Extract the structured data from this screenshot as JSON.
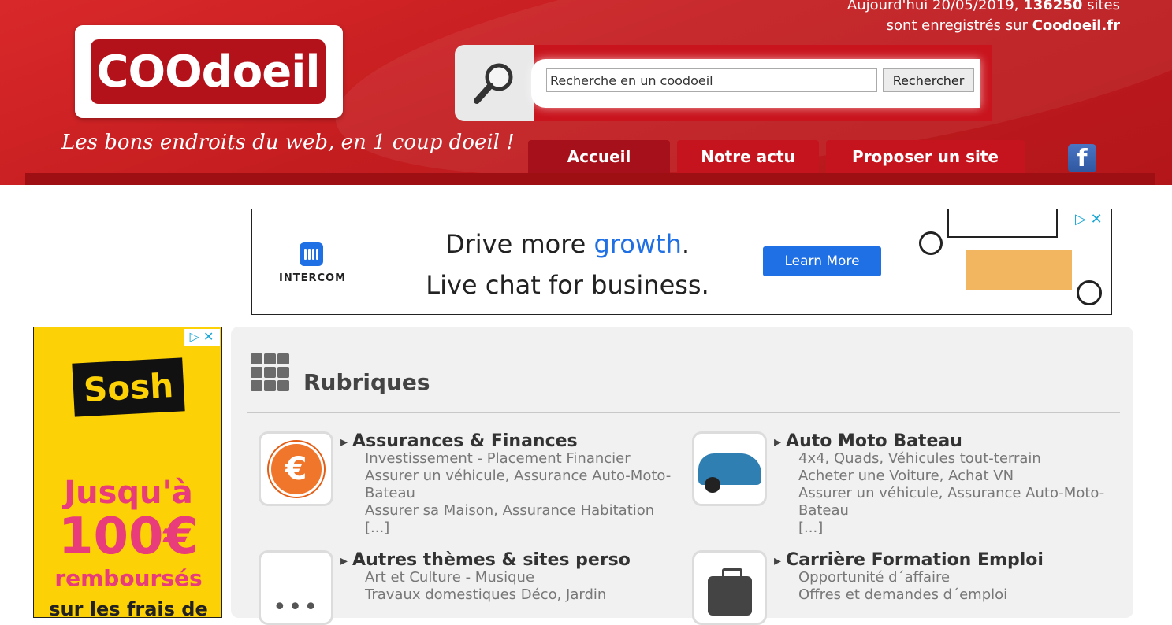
{
  "header": {
    "date_prefix": "Aujourd'hui 20/05/2019,",
    "site_count": "136250",
    "date_suffix": "sites",
    "registered_line": "sont enregistrés sur",
    "site_name": "Coodoeil.fr",
    "logo_text": "COOdoeil",
    "tagline": "Les bons endroits du web, en 1 coup doeil !"
  },
  "search": {
    "input_value": "Recherche en un coodoeil",
    "button_label": "Rechercher"
  },
  "nav": {
    "items": [
      {
        "label": "Accueil"
      },
      {
        "label": "Notre actu"
      },
      {
        "label": "Proposer un site"
      }
    ],
    "facebook_icon": "f"
  },
  "banner_ad": {
    "brand": "INTERCOM",
    "headline_1a": "Drive more ",
    "headline_1b": "growth",
    "headline_1c": ".",
    "headline_2": "Live chat for business.",
    "cta": "Learn More",
    "choice": "▷ ✕",
    "accent_color": "#1f6fe5"
  },
  "side_ad": {
    "brand": "Sosh",
    "line1": "Jusqu'à",
    "line2": "100€",
    "line3": "remboursés",
    "line4": "sur les frais de",
    "choice": "▷ ✕"
  },
  "main": {
    "section_title": "Rubriques",
    "categories": [
      {
        "title": "Assurances & Finances",
        "subs": [
          "Investissement - Placement Financier",
          "Assurer un véhicule, Assurance Auto-Moto-Bateau",
          "Assurer sa Maison, Assurance Habitation",
          "[...]"
        ],
        "icon": "euro-icon"
      },
      {
        "title": "Auto Moto Bateau",
        "subs": [
          "4x4, Quads, Véhicules tout-terrain",
          "Acheter une Voiture, Achat VN",
          "Assurer un véhicule, Assurance Auto-Moto-Bateau",
          "[...]"
        ],
        "icon": "car-icon"
      },
      {
        "title": "Autres thèmes & sites perso",
        "subs": [
          "Art et Culture - Musique",
          "Travaux domestiques Déco, Jardin"
        ],
        "icon": "dots-icon"
      },
      {
        "title": "Carrière Formation Emploi",
        "subs": [
          "Opportunité d´affaire",
          "Offres et demandes d´emploi"
        ],
        "icon": "briefcase-icon"
      }
    ]
  }
}
